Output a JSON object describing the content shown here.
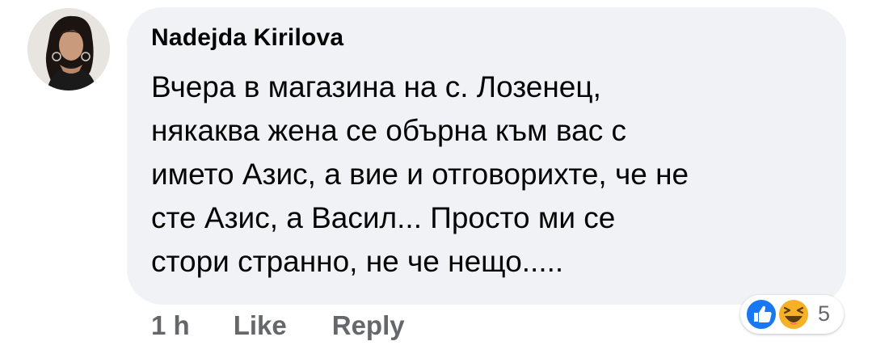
{
  "comment": {
    "author": "Nadejda Kirilova",
    "text": "Вчера в магазина на с. Лозенец,\nнякаква жена се обърна към вас с\nимето Азис, а вие и отговорихте, че не\nсте Азис, а Васил... Просто ми се\nстори странно, не че нещо.....",
    "avatar_icon": "profile-photo"
  },
  "actions": {
    "time": "1 h",
    "like": "Like",
    "reply": "Reply"
  },
  "reactions": {
    "icons": [
      "like-reaction-icon",
      "haha-reaction-icon"
    ],
    "count": "5",
    "colors": {
      "like": "#1877f2",
      "haha": "#f7b125"
    }
  }
}
